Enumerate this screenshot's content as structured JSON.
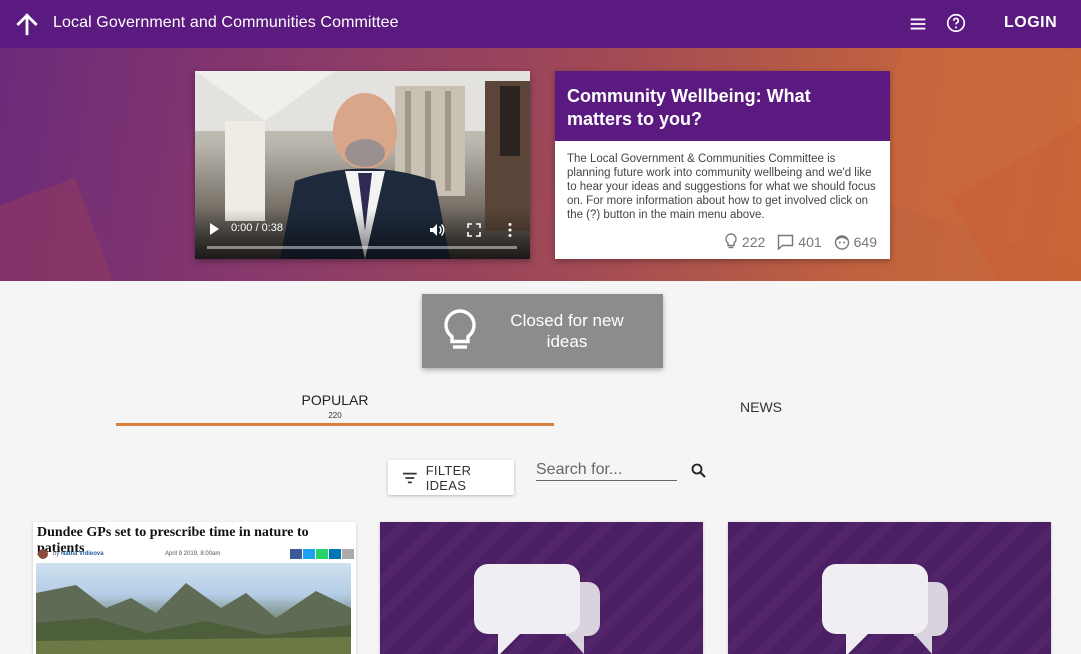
{
  "app_bar": {
    "title": "Local Government and Communities Committee",
    "login_label": "LOGIN",
    "back_icon": "arrow-up-icon",
    "menu_icon": "hamburger-menu-icon",
    "help_icon": "help-circle-icon"
  },
  "video": {
    "time": "0:00 / 0:38",
    "progress": 0
  },
  "info_card": {
    "title": "Community Wellbeing: What matters to you?",
    "description": "The Local Government & Communities Committee is planning future work into community wellbeing and we'd like to hear your ideas and suggestions for what we should focus on. For more information about how to get involved click on the (?) button in the main menu above.",
    "ideas_count": "222",
    "comments_count": "401",
    "users_count": "649"
  },
  "closed": {
    "label": "Closed for new ideas"
  },
  "tabs": {
    "popular_label": "POPULAR",
    "popular_count": "220",
    "news_label": "NEWS"
  },
  "filter": {
    "label": "FILTER IDEAS"
  },
  "search": {
    "placeholder": "Search for..."
  },
  "cards": {
    "news_headline": "Dundee GPs set to prescribe time in nature to patients",
    "news_author_prefix": "by",
    "news_author": "Nadia Vidieova",
    "news_date": "April 9 2019, 8:00am"
  },
  "colors": {
    "primary": "#5a1a7f",
    "accent": "#d8803e",
    "closed_box": "#8c8c8c"
  }
}
